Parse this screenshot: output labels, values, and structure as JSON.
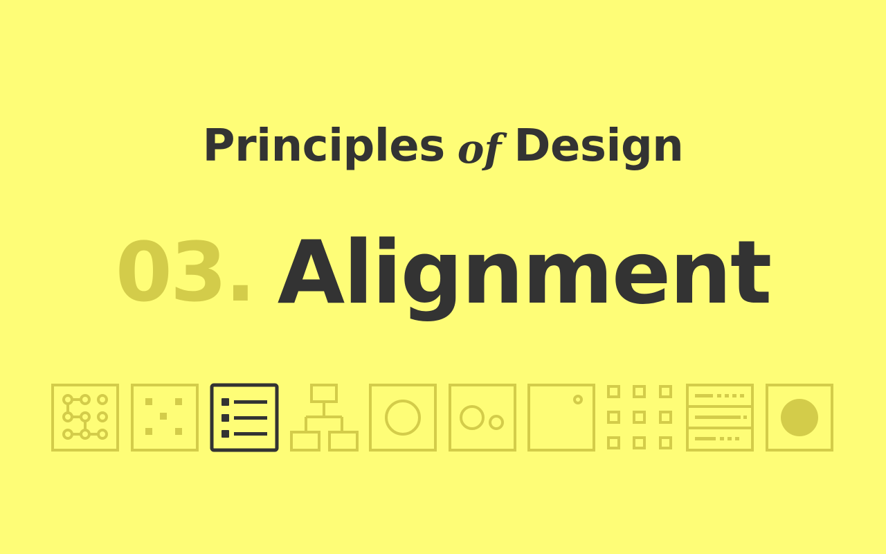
{
  "header": {
    "title_part1": "Principles",
    "title_connector": "of",
    "title_part2": "Design"
  },
  "main": {
    "number": "03.",
    "topic": "Alignment"
  },
  "colors": {
    "background": "#FEFD77",
    "text_dark": "#333333",
    "muted_olive": "#D3CC4A"
  },
  "icons": {
    "active_index": 3,
    "items": [
      "grid-network-icon",
      "scattered-dots-icon",
      "list-alignment-icon",
      "hierarchy-icon",
      "centered-circle-icon",
      "two-circles-icon",
      "corner-dot-icon",
      "dot-grid-icon",
      "stacked-rows-icon",
      "filled-circle-icon"
    ]
  }
}
